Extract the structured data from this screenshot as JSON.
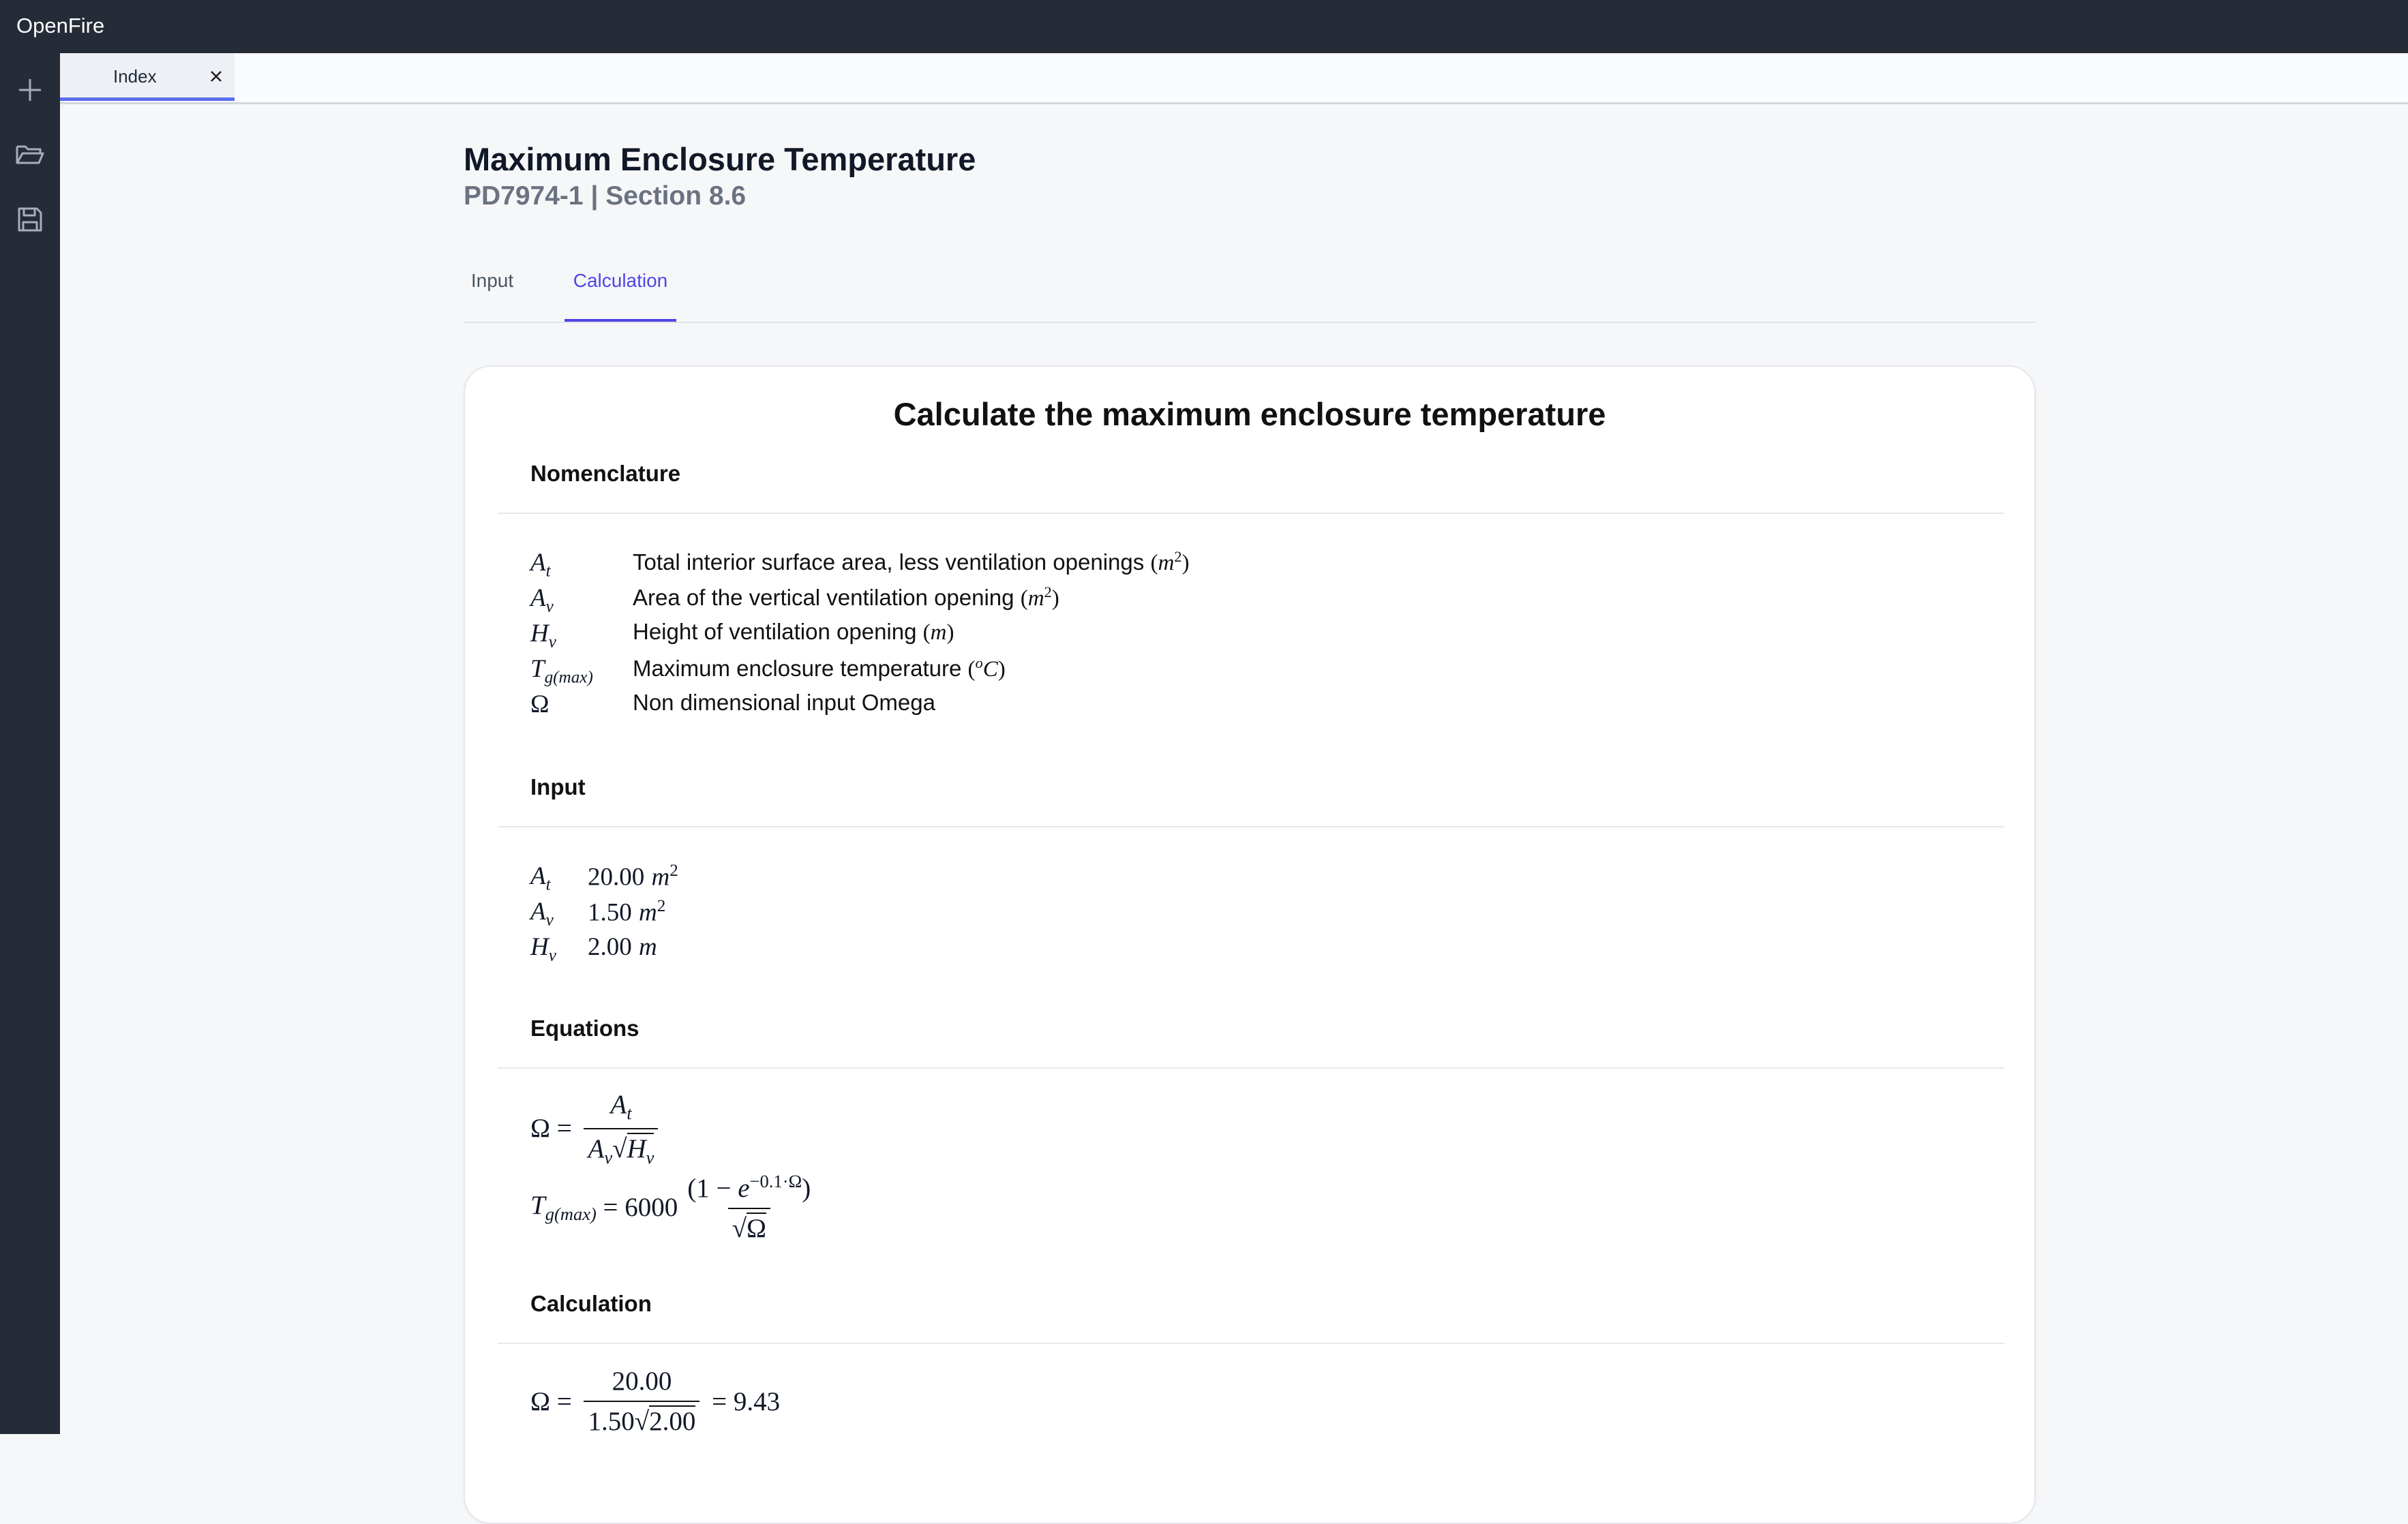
{
  "app": {
    "title": "OpenFire"
  },
  "sidebar": {
    "items": [
      {
        "icon": "plus-icon"
      },
      {
        "icon": "folder-open-icon"
      },
      {
        "icon": "save-icon"
      }
    ]
  },
  "file_tabs": [
    {
      "label": "Index",
      "close_icon": "close-icon"
    }
  ],
  "page": {
    "title": "Maximum Enclosure Temperature",
    "subtitle": "PD7974-1 | Section 8.6",
    "tabs": [
      {
        "label": "Input",
        "active": false
      },
      {
        "label": "Calculation",
        "active": true
      }
    ]
  },
  "card": {
    "title": "Calculate the maximum enclosure temperature",
    "nomenclature": {
      "heading": "Nomenclature",
      "items": [
        {
          "sym": "A",
          "sub": "t",
          "desc": "Total interior surface area, less ventilation openings",
          "unit": "m",
          "unit_sup": "2"
        },
        {
          "sym": "A",
          "sub": "v",
          "desc": "Area of the vertical ventilation opening",
          "unit": "m",
          "unit_sup": "2"
        },
        {
          "sym": "H",
          "sub": "v",
          "desc": "Height of ventilation opening",
          "unit": "m",
          "unit_sup": ""
        },
        {
          "sym": "T",
          "sub": "g(max)",
          "desc": "Maximum enclosure temperature",
          "unit": "C",
          "unit_sup": "o"
        },
        {
          "sym": "Ω",
          "sub": "",
          "desc": "Non dimensional input Omega",
          "unit": "",
          "unit_sup": ""
        }
      ]
    },
    "input": {
      "heading": "Input",
      "items": [
        {
          "sym": "A",
          "sub": "t",
          "value": "20.00",
          "unit": "m",
          "unit_sup": "2"
        },
        {
          "sym": "A",
          "sub": "v",
          "value": "1.50",
          "unit": "m",
          "unit_sup": "2"
        },
        {
          "sym": "H",
          "sub": "v",
          "value": "2.00",
          "unit": "m",
          "unit_sup": ""
        }
      ]
    },
    "equations": {
      "heading": "Equations",
      "omega": {
        "lhs": "Ω",
        "num_sym": "A",
        "num_sub": "t",
        "den_sym1": "A",
        "den_sub1": "v",
        "den_sym2": "H",
        "den_sub2": "v"
      },
      "tmax": {
        "lhs_sym": "T",
        "lhs_sub": "g(max)",
        "coef": "6000",
        "num_open": "(1 − ",
        "num_e": "e",
        "num_exp": "−0.1·Ω",
        "num_close": ")",
        "den": "Ω"
      }
    },
    "calculation": {
      "heading": "Calculation",
      "omega": {
        "lhs": "Ω",
        "num": "20.00",
        "den_coef": "1.50",
        "den_root": "2.00",
        "result": "9.43"
      }
    }
  }
}
